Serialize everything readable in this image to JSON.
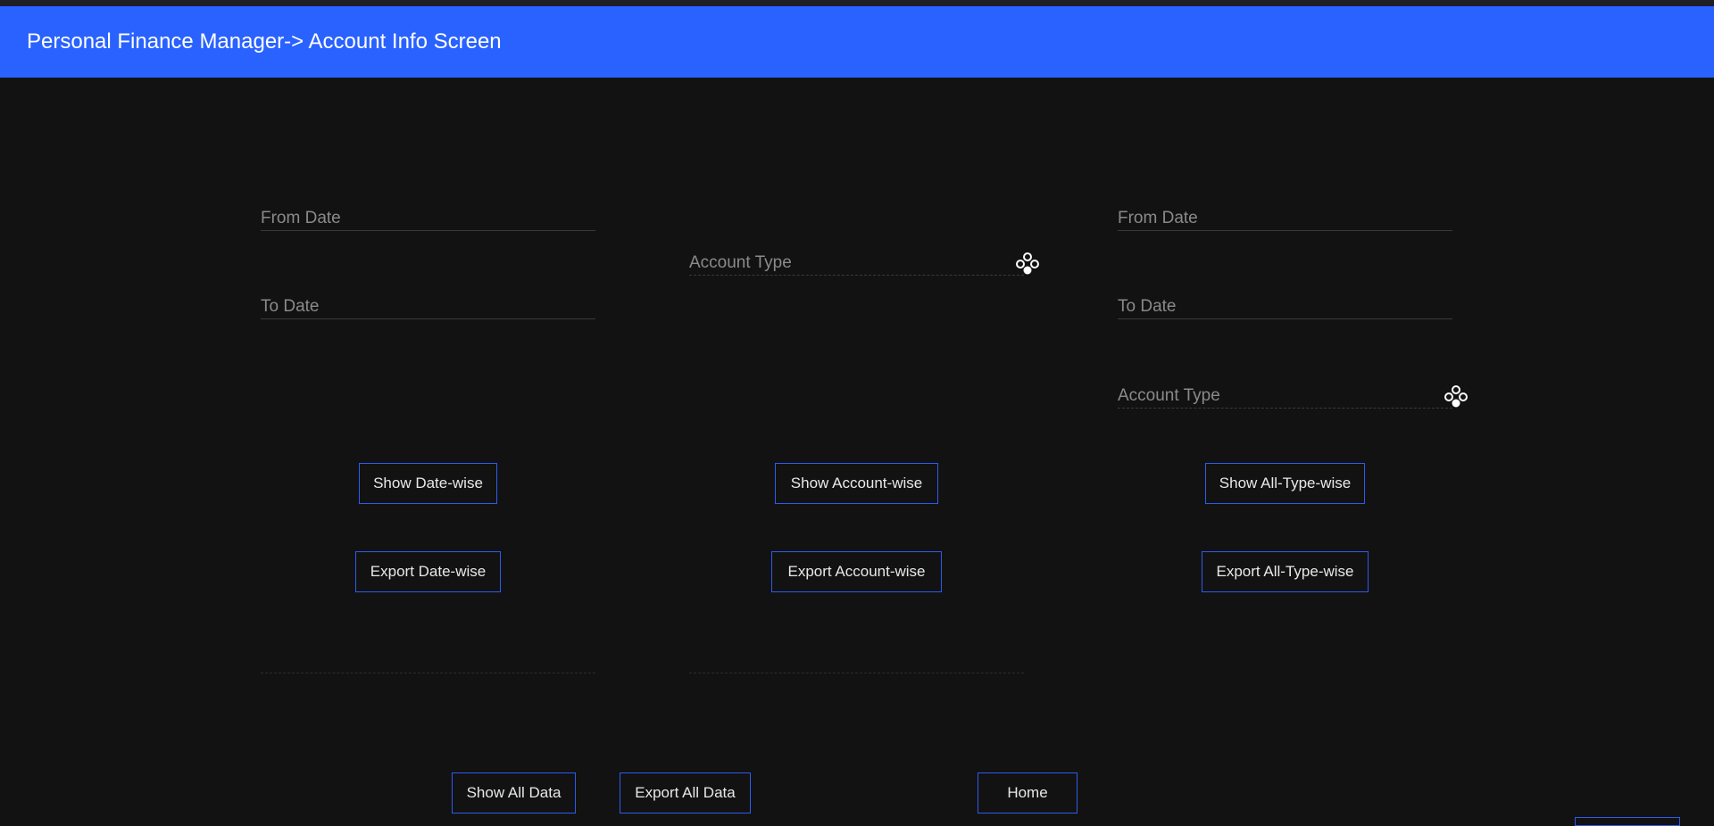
{
  "header": {
    "title": "Personal Finance Manager-> Account Info Screen"
  },
  "date_panel": {
    "from_label": "From Date",
    "to_label": "To Date",
    "show_label": "Show Date-wise",
    "export_label": "Export Date-wise"
  },
  "account_panel": {
    "type_label": "Account Type",
    "type_icon": "dropdown-icon",
    "show_label": "Show Account-wise",
    "export_label": "Export Account-wise"
  },
  "all_type_panel": {
    "from_label": "From Date",
    "to_label": "To Date",
    "type_label": "Account Type",
    "type_icon": "dropdown-icon",
    "show_label": "Show All-Type-wise",
    "export_label": "Export All-Type-wise"
  },
  "footer": {
    "show_all_label": "Show All Data",
    "export_all_label": "Export All Data",
    "home_label": "Home"
  },
  "colors": {
    "header_bg": "#2962ff",
    "page_bg": "#121212",
    "button_border": "#2d5bf0",
    "label_text": "#8a8a8a"
  }
}
